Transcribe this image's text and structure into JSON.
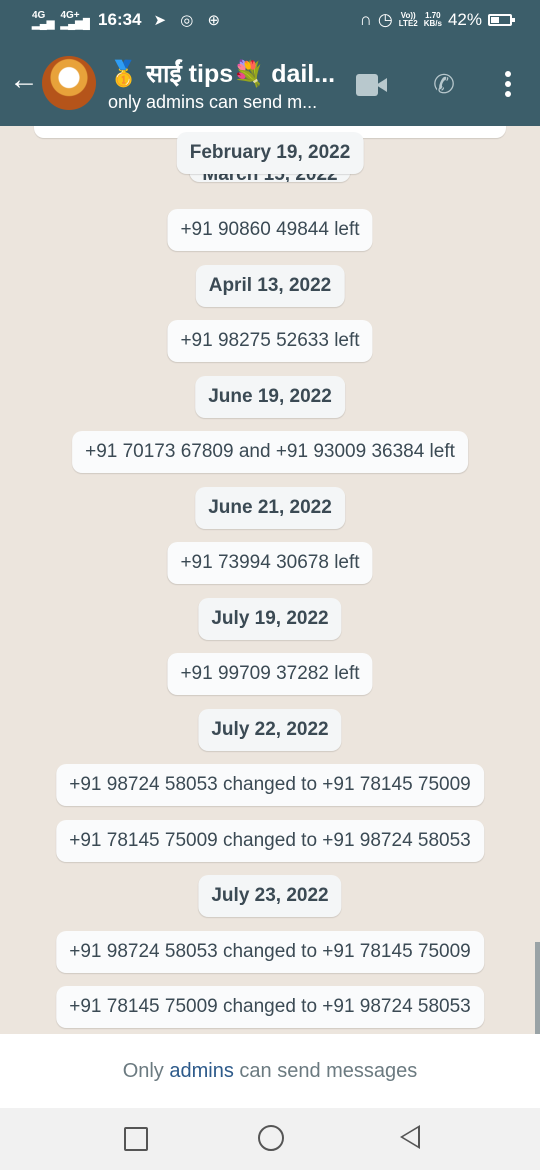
{
  "status_bar": {
    "net1": "4G",
    "net2": "4G+",
    "time": "16:34",
    "notif_icons": "➤ ◎ ⊕",
    "volte": "Vo))\nLTE2",
    "speed": "1.70\nKB/s",
    "battery_percent": "42%",
    "battery_level": 0.42
  },
  "header": {
    "back_glyph": "←",
    "title": "🥇 साईं tips💐 dail...",
    "subtitle": "only admins can send m...",
    "call_glyph": "✆"
  },
  "chat": {
    "items": [
      {
        "type": "date",
        "text": "February 19, 2022"
      },
      {
        "type": "date",
        "text": "March 15, 2022"
      },
      {
        "type": "notice",
        "text": "+91 90860 49844 left"
      },
      {
        "type": "date",
        "text": "April 13, 2022"
      },
      {
        "type": "notice",
        "text": "+91 98275 52633 left"
      },
      {
        "type": "date",
        "text": "June 19, 2022"
      },
      {
        "type": "notice",
        "text": "+91 70173 67809 and +91 93009 36384 left"
      },
      {
        "type": "date",
        "text": "June 21, 2022"
      },
      {
        "type": "notice",
        "text": "+91 73994 30678 left"
      },
      {
        "type": "date",
        "text": "July 19, 2022"
      },
      {
        "type": "notice",
        "text": "+91 99709 37282 left"
      },
      {
        "type": "date",
        "text": "July 22, 2022"
      },
      {
        "type": "notice",
        "text": "+91 98724 58053 changed to +91 78145 75009"
      },
      {
        "type": "notice",
        "text": "+91 78145 75009 changed to +91 98724 58053"
      },
      {
        "type": "date",
        "text": "July 23, 2022"
      },
      {
        "type": "notice",
        "text": "+91 98724 58053 changed to +91 78145 75009"
      },
      {
        "type": "notice",
        "text": "+91 78145 75009 changed to +91 98724 58053"
      }
    ]
  },
  "footer": {
    "prefix": "Only ",
    "admins": "admins",
    "suffix": " can send messages"
  },
  "colors": {
    "header_bg": "#3c5e6a",
    "chat_bg": "#ece5dd",
    "link": "#2d5a8a"
  }
}
